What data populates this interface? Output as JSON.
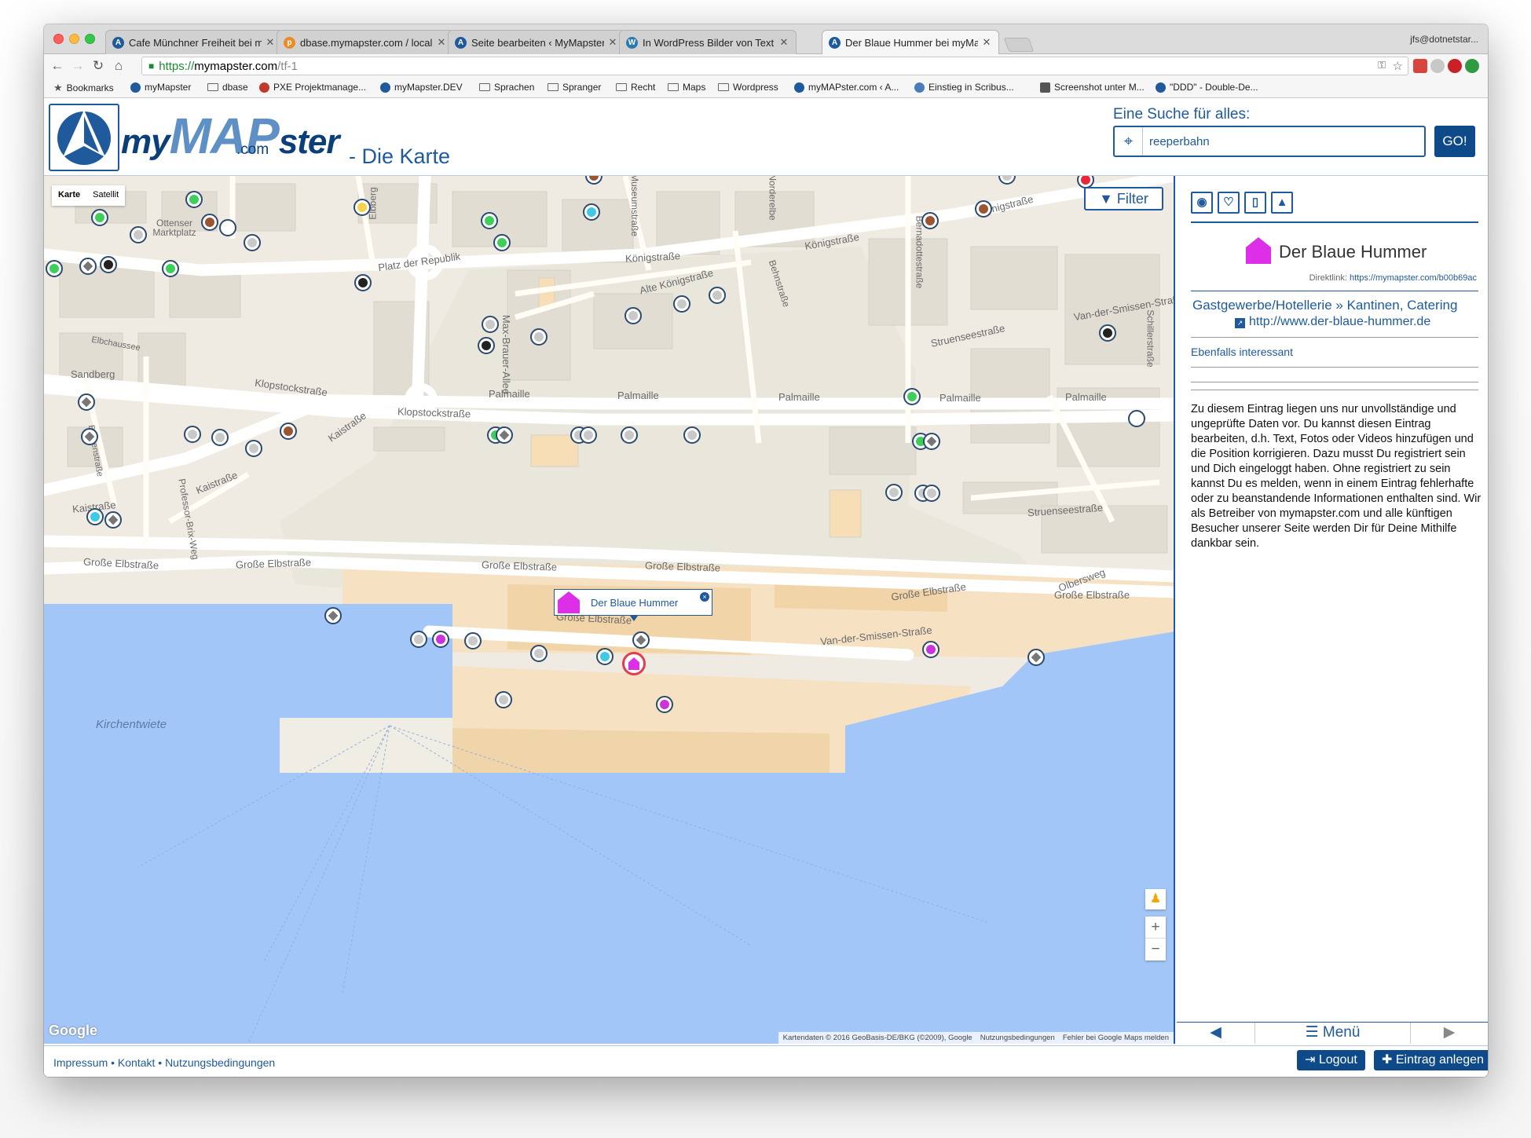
{
  "browser": {
    "tabs": [
      {
        "title": "Cafe Münchner Freiheit bei my",
        "active": false
      },
      {
        "title": "dbase.mymapster.com / localh",
        "active": false
      },
      {
        "title": "Seite bearbeiten ‹ MyMapster.",
        "active": false
      },
      {
        "title": "In WordPress Bilder von Text u",
        "active": false
      },
      {
        "title": "Der Blaue Hummer bei myMap",
        "active": true
      }
    ],
    "user": "jfs@dotnetstar...",
    "url_scheme": "https://",
    "url_host": "mymapster.com",
    "url_path": "/tf-1",
    "bookmarks": [
      {
        "label": "Bookmarks",
        "icon": "star-icon"
      },
      {
        "label": "myMapster",
        "icon": "site-icon"
      },
      {
        "label": "dbase",
        "icon": "folder-icon"
      },
      {
        "label": "PXE Projektmanage...",
        "icon": "site-icon"
      },
      {
        "label": "myMapster.DEV",
        "icon": "site-icon"
      },
      {
        "label": "Sprachen",
        "icon": "folder-icon"
      },
      {
        "label": "Spranger",
        "icon": "folder-icon"
      },
      {
        "label": "Recht",
        "icon": "folder-icon"
      },
      {
        "label": "Maps",
        "icon": "folder-icon"
      },
      {
        "label": "Wordpress",
        "icon": "folder-icon"
      },
      {
        "label": "myMAPster.com ‹ A...",
        "icon": "site-icon"
      },
      {
        "label": "Einstieg in Scribus...",
        "icon": "site-icon"
      },
      {
        "label": "Screenshot unter M...",
        "icon": "site-icon"
      },
      {
        "label": "\"DDD\" - Double-De...",
        "icon": "site-icon"
      }
    ]
  },
  "header": {
    "logo_my": "my",
    "logo_map": "MAP",
    "logo_ster": "ster",
    "logo_com": ".com",
    "subtitle": "- Die Karte",
    "search_label": "Eine Suche für alles:",
    "search_value": "reeperbahn",
    "go_label": "GO!"
  },
  "map": {
    "type_map": "Karte",
    "type_satellite": "Satellit",
    "filter_label": "Filter",
    "popup_title": "Der Blaue Hummer",
    "google": "Google",
    "attribution": [
      "Kartendaten © 2016 GeoBasis-DE/BKG (©2009), Google",
      "Nutzungsbedingungen",
      "Fehler bei Google Maps melden"
    ],
    "labels": [
      "Ottenser Marktplatz",
      "Platz der Republik",
      "Königstraße",
      "Königstraße",
      "Alte Königstraße",
      "Königstraße",
      "Klopstockstraße",
      "Max-Brauer-Allee",
      "Palmaille",
      "Palmaille",
      "Palmaille",
      "Palmaille",
      "Palmaille",
      "Klopstockstraße",
      "Kaistraße",
      "Kaistraße",
      "Kaistraße",
      "Große Elbstraße",
      "Große Elbstraße",
      "Große Elbstraße",
      "Große Elbstraße",
      "Große Elbstraße",
      "Große Elbstraße",
      "Große Elbstraße",
      "Van-der-Smissen-Straße",
      "Van-der-Smissen-Straße",
      "Struenseestraße",
      "Struenseestraße",
      "Olbersweg",
      "Sandberg",
      "Elbchaussee",
      "Kirchentwiete",
      "Norderelbe",
      "Bernadottestraße",
      "Behnstraße",
      "Professor-Brix-Weg",
      "Elbberg",
      "Museumstraße",
      "Schillerstraße",
      "Behrenstraße"
    ]
  },
  "panel": {
    "title": "Der Blaue Hummer",
    "direct_link_label": "Direktlink:",
    "direct_link_url": "https://mymapster.com/b00b69ac",
    "category": "Gastgewerbe/Hotellerie",
    "subcategory": "Kantinen, Catering",
    "website": "http://www.der-blaue-hummer.de",
    "also_interesting": "Ebenfalls interessant",
    "description": "Zu diesem Eintrag liegen uns nur unvollständige und ungeprüfte Daten vor. Du kannst diesen Eintrag bearbeiten, d.h. Text, Fotos oder Videos hinzufügen und die Position korrigieren. Dazu musst Du registriert sein und Dich eingeloggt haben. Ohne registriert zu sein kannst Du es melden, wenn in einem Eintrag fehlerhafte oder zu beanstandende Informationen enthalten sind. Wir als Betreiber von mymapster.com und alle künftigen Besucher unserer Seite werden Dir für Deine Mithilfe dankbar sein.",
    "menu_label": "Menü"
  },
  "footer": {
    "links": "Impressum • Kontakt • Nutzungsbedingungen",
    "logout_label": "Logout",
    "new_entry_label": "Eintrag anlegen"
  },
  "colors": {
    "brand": "#1e5a9c",
    "brand_dark": "#0e4a8a",
    "entry_pink": "#dd2fe8",
    "water": "#a3c6f8"
  }
}
